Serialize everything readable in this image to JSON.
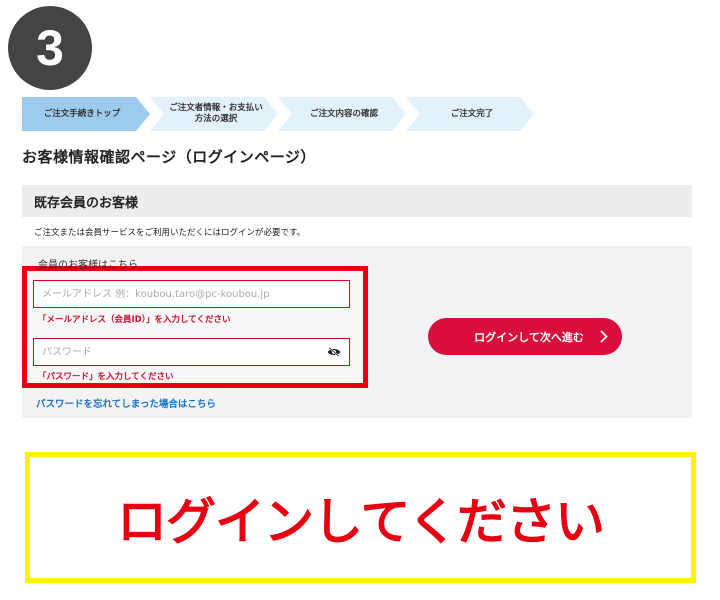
{
  "step_number": "3",
  "steps": [
    {
      "label": "ご注文手続きトップ"
    },
    {
      "label": "ご注文者情報・お支払い方法の選択"
    },
    {
      "label": "ご注文内容の確認"
    },
    {
      "label": "ご注文完了"
    }
  ],
  "steps_active_index": 0,
  "page_title": "お客様情報確認ページ（ログインページ）",
  "section": {
    "title": "既存会員のお客様",
    "notice": "ご注文または会員サービスをご利用いただくにはログインが必要です。",
    "panel_label": "会員のお客様はこちら"
  },
  "login_form": {
    "email_placeholder": "メールアドレス 例：koubou.taro@pc-koubou.jp",
    "email_value": "",
    "email_error": "「メールアドレス（会員ID）」を入力してください",
    "password_placeholder": "パスワード",
    "password_value": "",
    "password_error": "「パスワード」を入力してください",
    "forgot_link": "パスワードを忘れてしまった場合はこちら",
    "submit_label": "ログインして次へ進む"
  },
  "banner_text": "ログインしてください",
  "icons": {
    "password_toggle": "eye-slash-icon",
    "submit_arrow": "chevron-right-icon"
  },
  "colors": {
    "accent_red": "#d90e3c",
    "highlight_red": "#e60012",
    "banner_border": "#fff200",
    "step_active": "#9ccbee",
    "step_inactive": "#e3f1fb",
    "link_blue": "#1a73c8"
  }
}
